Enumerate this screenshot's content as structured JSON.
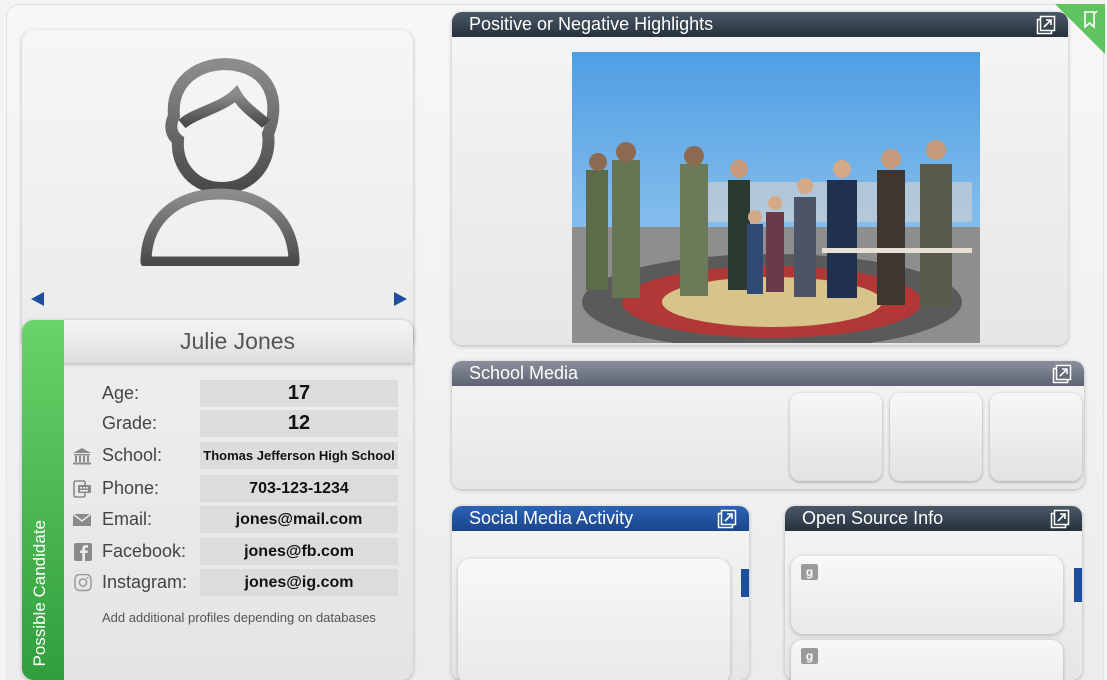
{
  "profile": {
    "name": "Julie Jones",
    "status": "Possible Candidate",
    "fields": [
      {
        "label": "Age:",
        "value": "17",
        "icon": "none",
        "value_size": "20px"
      },
      {
        "label": "Grade:",
        "value": "12",
        "icon": "none",
        "value_size": "20px"
      },
      {
        "label": "School:",
        "value": "Thomas Jefferson High School",
        "icon": "school-icon",
        "value_size": "13px"
      },
      {
        "label": "Phone:",
        "value": "703-123-1234",
        "icon": "phone-icon",
        "value_size": "16px"
      },
      {
        "label": "Email:",
        "value": "jones@mail.com",
        "icon": "email-icon",
        "value_size": "16px"
      },
      {
        "label": "Facebook:",
        "value": "jones@fb.com",
        "icon": "facebook-icon",
        "value_size": "16px"
      },
      {
        "label": "Instagram:",
        "value": "jones@ig.com",
        "icon": "instagram-icon",
        "value_size": "16px"
      }
    ],
    "note": "Add additional profiles depending on databases"
  },
  "panels": {
    "highlights": {
      "title": "Positive or Negative Highlights"
    },
    "school_media": {
      "title": "School Media"
    },
    "social_media": {
      "title": "Social Media Activity"
    },
    "open_source": {
      "title": "Open Source Info",
      "item_icon_letter": "g"
    }
  },
  "colors": {
    "candidate_green": "#4caf50",
    "nav_blue": "#1e4f9e",
    "header_dark": "#2d3743",
    "header_gray": "#6c7282",
    "header_blue": "#1f4d96"
  }
}
